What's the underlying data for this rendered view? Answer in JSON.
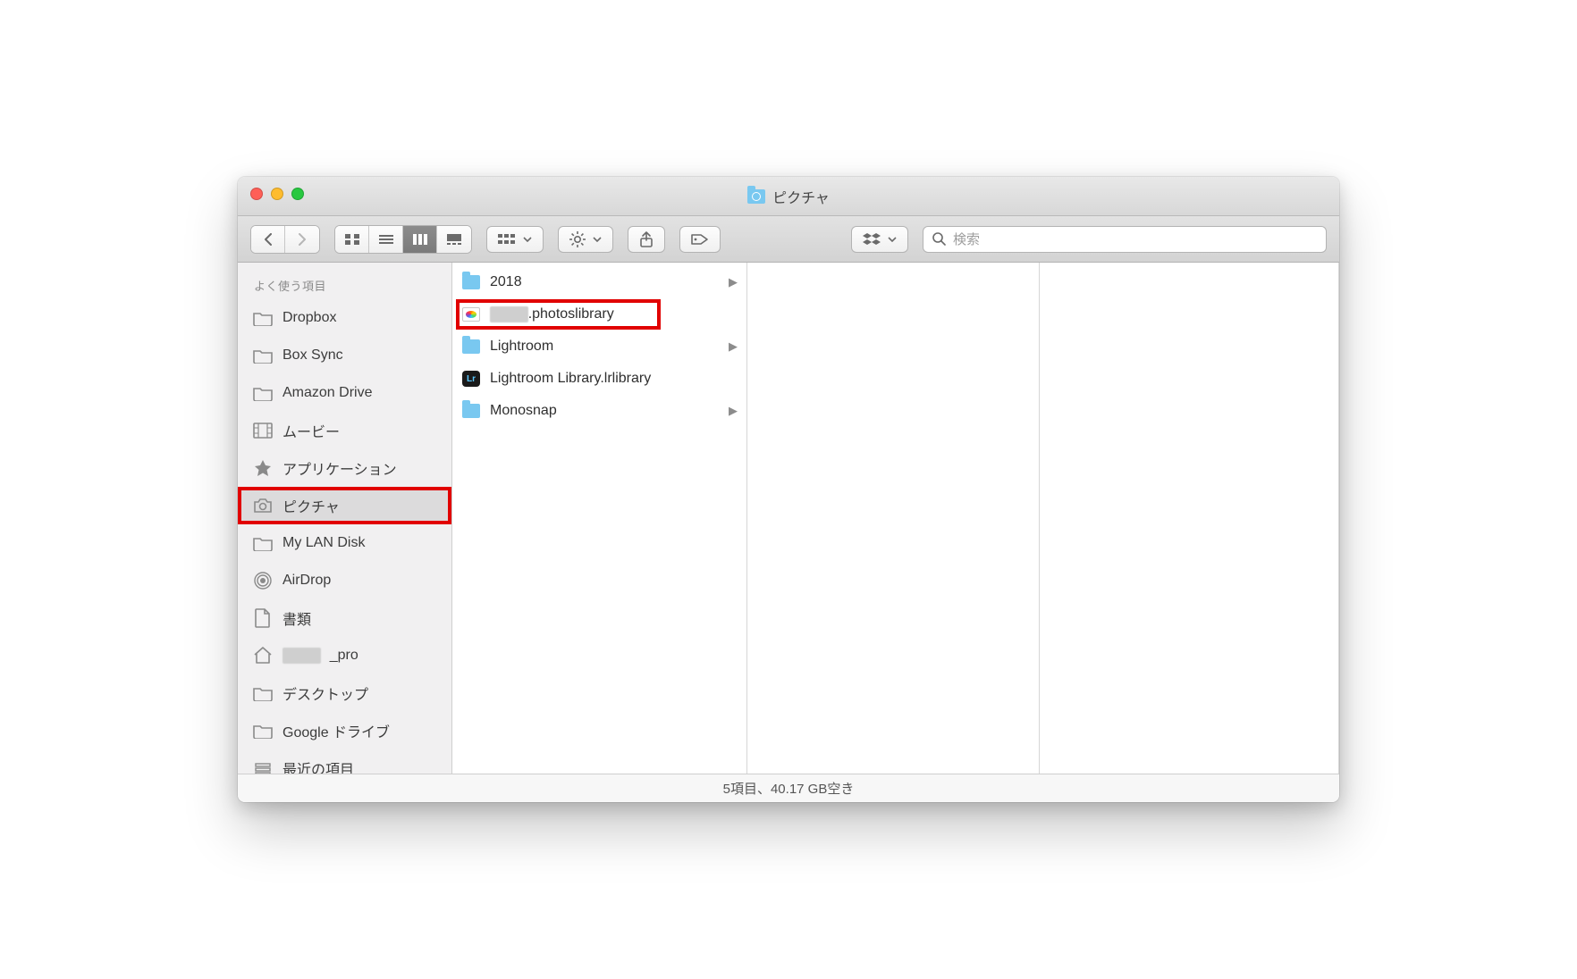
{
  "window": {
    "title": "ピクチャ"
  },
  "toolbar": {
    "search_placeholder": "検索"
  },
  "sidebar": {
    "header": "よく使う項目",
    "items": [
      {
        "label": "Dropbox",
        "icon": "folder"
      },
      {
        "label": "Box Sync",
        "icon": "folder"
      },
      {
        "label": "Amazon Drive",
        "icon": "folder"
      },
      {
        "label": "ムービー",
        "icon": "movie"
      },
      {
        "label": "アプリケーション",
        "icon": "apps"
      },
      {
        "label": "ピクチャ",
        "icon": "camera",
        "selected": true,
        "highlight": true
      },
      {
        "label": "My LAN Disk",
        "icon": "folder"
      },
      {
        "label": "AirDrop",
        "icon": "airdrop"
      },
      {
        "label": "書類",
        "icon": "doc"
      },
      {
        "label": "_pro",
        "icon": "home",
        "blurred_prefix": true
      },
      {
        "label": "デスクトップ",
        "icon": "folder"
      },
      {
        "label": "Google ドライブ",
        "icon": "folder"
      },
      {
        "label": "最近の項目",
        "icon": "recent"
      }
    ]
  },
  "list": [
    {
      "label": "2018",
      "icon": "folder",
      "has_children": true
    },
    {
      "label": ".photoslibrary",
      "icon": "photoslib",
      "blurred_prefix": true,
      "highlight": true
    },
    {
      "label": "Lightroom",
      "icon": "folder",
      "has_children": true
    },
    {
      "label": "Lightroom Library.lrlibrary",
      "icon": "lrlib"
    },
    {
      "label": "Monosnap",
      "icon": "folder",
      "has_children": true
    }
  ],
  "status": {
    "text": "5項目、40.17 GB空き"
  }
}
